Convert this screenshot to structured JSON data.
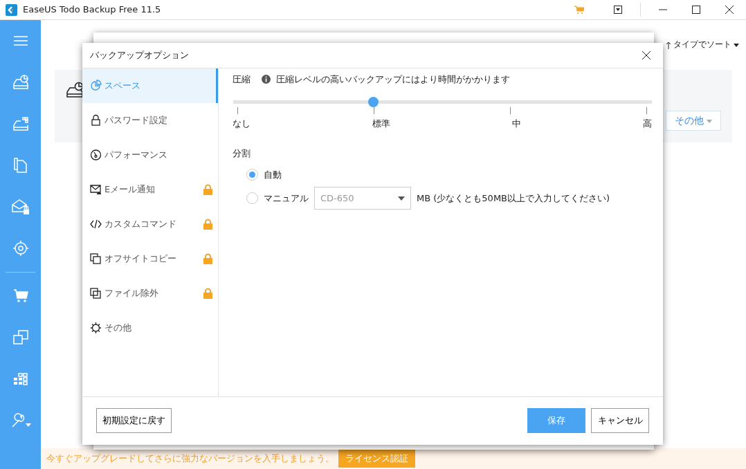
{
  "window": {
    "title": "EaseUS Todo Backup Free 11.5"
  },
  "main": {
    "sort_label": "タイプでソート",
    "more_button": "その他"
  },
  "banner": {
    "text": "今すぐアップグレードしてさらに強力なバージョンを入手しましょう。",
    "button": "ライセンス認証"
  },
  "dialog": {
    "title": "バックアップオプション",
    "nav": [
      {
        "label": "スペース",
        "selected": true,
        "locked": false
      },
      {
        "label": "パスワード設定",
        "selected": false,
        "locked": false
      },
      {
        "label": "パフォーマンス",
        "selected": false,
        "locked": false
      },
      {
        "label": "Eメール通知",
        "selected": false,
        "locked": true
      },
      {
        "label": "カスタムコマンド",
        "selected": false,
        "locked": true
      },
      {
        "label": "オフサイトコピー",
        "selected": false,
        "locked": true
      },
      {
        "label": "ファイル除外",
        "selected": false,
        "locked": true
      },
      {
        "label": "その他",
        "selected": false,
        "locked": false
      }
    ],
    "compression": {
      "label": "圧縮",
      "hint": "圧縮レベルの高いバックアップにはより時間がかかります",
      "level": 0.33,
      "ticks": [
        "なし",
        "標準",
        "中",
        "高"
      ]
    },
    "split": {
      "label": "分割",
      "options": [
        {
          "label": "自動",
          "selected": true
        },
        {
          "label": "マニュアル",
          "selected": false
        }
      ],
      "select_value": "CD-650",
      "note": "MB (少なくとも50MB以上で入力してください)"
    },
    "buttons": {
      "reset": "初期設定に戻す",
      "save": "保存",
      "cancel": "キャンセル"
    }
  }
}
